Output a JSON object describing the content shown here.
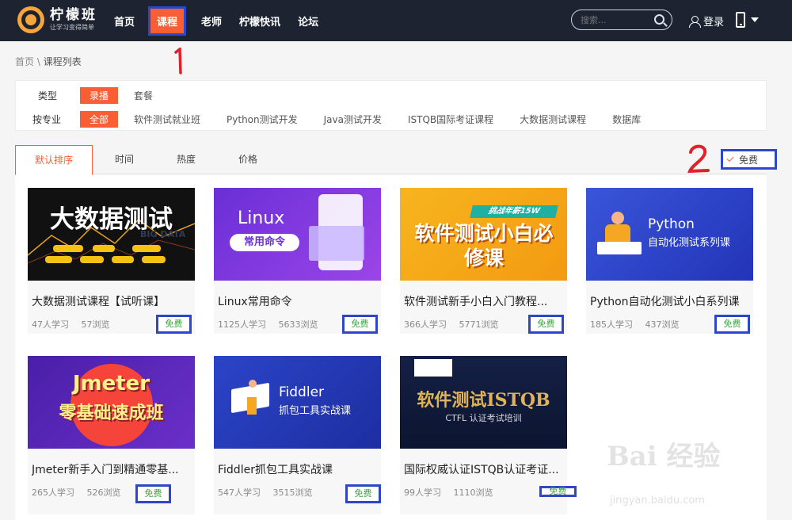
{
  "header": {
    "logo_name": "柠檬班",
    "logo_slogan": "让学习变得简单",
    "nav": [
      "首页",
      "课程",
      "老师",
      "柠檬快讯",
      "论坛"
    ],
    "search_placeholder": "搜索...",
    "login_label": "登录"
  },
  "breadcrumb": {
    "home": "首页",
    "sep": "\\",
    "current": "课程列表"
  },
  "annotations": {
    "one": "1",
    "two": "2"
  },
  "filters": {
    "type_label": "类型",
    "type_options": [
      "录播",
      "套餐"
    ],
    "major_label": "按专业",
    "major_options": [
      "全部",
      "软件测试就业班",
      "Python测试开发",
      "Java测试开发",
      "ISTQB国际考证课程",
      "大数据测试课程",
      "数据库"
    ]
  },
  "sort": {
    "tabs": [
      "默认排序",
      "时间",
      "热度",
      "价格"
    ],
    "free_filter": "免费"
  },
  "courses": [
    {
      "title": "大数据测试课程【试听课】",
      "learners": "47人学习",
      "views": "57浏览",
      "badge": "免费",
      "thumb_text": "大数据测试",
      "thumb_sub": "BIG DATA"
    },
    {
      "title": "Linux常用命令",
      "learners": "1125人学习",
      "views": "5633浏览",
      "badge": "免费",
      "thumb_text": "Linux",
      "thumb_sub": "常用命令"
    },
    {
      "title": "软件测试新手小白入门教程...",
      "learners": "366人学习",
      "views": "5771浏览",
      "badge": "免费",
      "thumb_text": "软件测试小白必修课",
      "thumb_sub": "挑战年薪15W"
    },
    {
      "title": "Python自动化测试小白系列课",
      "learners": "185人学习",
      "views": "437浏览",
      "badge": "免费",
      "thumb_text": "Python",
      "thumb_sub": "自动化测试系列课"
    },
    {
      "title": "Jmeter新手入门到精通零基...",
      "learners": "265人学习",
      "views": "526浏览",
      "badge": "免费",
      "thumb_text": "Jmeter",
      "thumb_sub": "零基础速成班"
    },
    {
      "title": "Fiddler抓包工具实战课",
      "learners": "547人学习",
      "views": "3515浏览",
      "badge": "免费",
      "thumb_text": "Fiddler",
      "thumb_sub": "抓包工具实战课"
    },
    {
      "title": "国际权威认证ISTQB认证考证...",
      "learners": "99人学习",
      "views": "1110浏览",
      "badge": "免费",
      "thumb_text": "软件测试ISTQB",
      "thumb_sub": "CTFL 认证考试培训"
    }
  ],
  "watermark": {
    "brand": "Bai 经验",
    "url": "jingyan.baidu.com"
  },
  "colors": {
    "header_bg": "#1d2331",
    "accent": "#f95e35",
    "annotation_box": "#2e46c8",
    "annotation_pen": "#e0202a",
    "free_green": "#3aa53a"
  }
}
